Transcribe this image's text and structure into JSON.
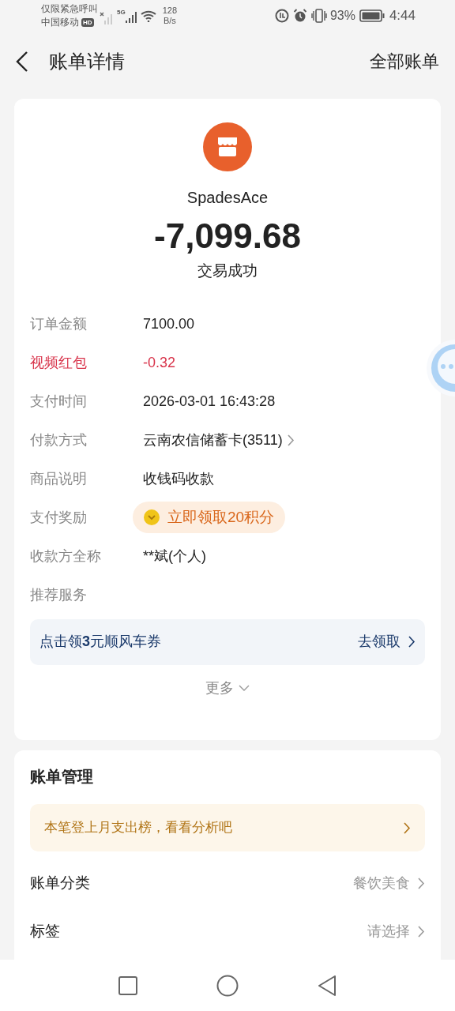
{
  "status_bar": {
    "emergency": "仅限紧急呼叫",
    "carrier": "中国移动",
    "hd": "HD",
    "network": "5G",
    "speed_value": "128",
    "speed_unit": "B/s",
    "battery": "93%",
    "time": "4:44"
  },
  "header": {
    "title": "账单详情",
    "right_link": "全部账单"
  },
  "merchant": {
    "name": "SpadesAce",
    "amount": "-7,099.68",
    "status": "交易成功"
  },
  "details": [
    {
      "kind": "text",
      "label": "订单金额",
      "value": "7100.00"
    },
    {
      "kind": "discount",
      "label": "视频红包",
      "value": "-0.32"
    },
    {
      "kind": "text",
      "label": "支付时间",
      "value": "2026-03-01 16:43:28"
    },
    {
      "kind": "link",
      "label": "付款方式",
      "value": "云南农信储蓄卡(3511)"
    },
    {
      "kind": "text",
      "label": "商品说明",
      "value": "收钱码收款"
    },
    {
      "kind": "reward",
      "label": "支付奖励",
      "value": "立即领取20积分"
    },
    {
      "kind": "text",
      "label": "收款方全称",
      "value": "**斌(个人)"
    },
    {
      "kind": "heading",
      "label": "推荐服务"
    }
  ],
  "promo": {
    "text": "点击领**3**元顺风车券",
    "action": "去领取"
  },
  "more": "更多",
  "management": {
    "title": "账单管理",
    "banner": "本笔登上月支出榜，看看分析吧",
    "rows": [
      {
        "label": "账单分类",
        "value": "餐饮美食"
      },
      {
        "label": "标签",
        "value": "请选择"
      }
    ]
  }
}
